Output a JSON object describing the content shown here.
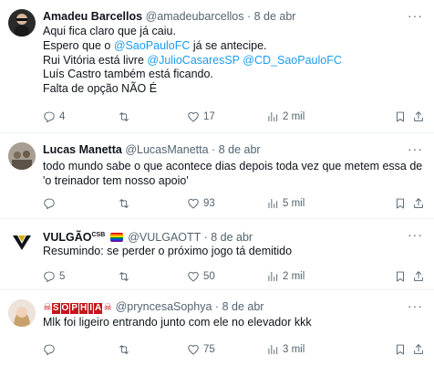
{
  "tweets": [
    {
      "name": "Amadeu Barcellos",
      "handle": "@amadeubarcellos",
      "dot": "·",
      "date": "8 de abr",
      "lines": [
        [
          {
            "t": "Aqui fica claro que já caiu."
          }
        ],
        [
          {
            "t": "Espero que o "
          },
          {
            "t": "@SaoPauloFC",
            "link": true
          },
          {
            "t": " já se antecipe."
          }
        ],
        [
          {
            "t": "Rui Vitória está livre "
          },
          {
            "t": "@JulioCasaresSP",
            "link": true
          },
          {
            "t": " "
          },
          {
            "t": "@CD_SaoPauloFC",
            "link": true
          }
        ],
        [
          {
            "t": "Luís Castro também está ficando."
          }
        ],
        [
          {
            "t": "Falta de opção NÃO É"
          }
        ]
      ],
      "replies": "4",
      "retweets": "",
      "likes": "17",
      "views": "2 mil"
    },
    {
      "name": "Lucas Manetta",
      "handle": "@LucasManetta",
      "dot": "·",
      "date": "8 de abr",
      "lines": [
        [
          {
            "t": "todo mundo sabe o que acontece dias depois toda vez que metem essa de"
          }
        ],
        [
          {
            "t": "'o treinador tem nosso apoio'"
          }
        ]
      ],
      "replies": "",
      "retweets": "",
      "likes": "93",
      "views": "5 mil"
    },
    {
      "name": "VULGÃO",
      "name_sup": "CSB",
      "handle": "@VULGAOTT",
      "dot": "·",
      "date": "8 de abr",
      "lines": [
        [
          {
            "t": "Resumindo: se perder o próximo jogo tá demitido"
          }
        ]
      ],
      "replies": "5",
      "retweets": "",
      "likes": "50",
      "views": "2 mil"
    },
    {
      "name_letters": [
        "S",
        "O",
        "P",
        "H",
        "I",
        "A"
      ],
      "handle": "@pryncesaSophya",
      "dot": "·",
      "date": "8 de abr",
      "lines": [
        [
          {
            "t": "Mlk foi ligeiro entrando junto com ele no elevador kkk"
          }
        ]
      ],
      "replies": "",
      "retweets": "",
      "likes": "75",
      "views": "3 mil"
    }
  ],
  "icons": {
    "reply": "reply-icon",
    "retweet": "retweet-icon",
    "like": "heart-icon",
    "views": "views-icon",
    "bookmark": "bookmark-icon",
    "share": "share-icon",
    "more": "more-icon"
  },
  "more_glyph": "···",
  "colors": {
    "link": "#1d9bf0",
    "muted": "#536471",
    "text": "#0f1419"
  }
}
